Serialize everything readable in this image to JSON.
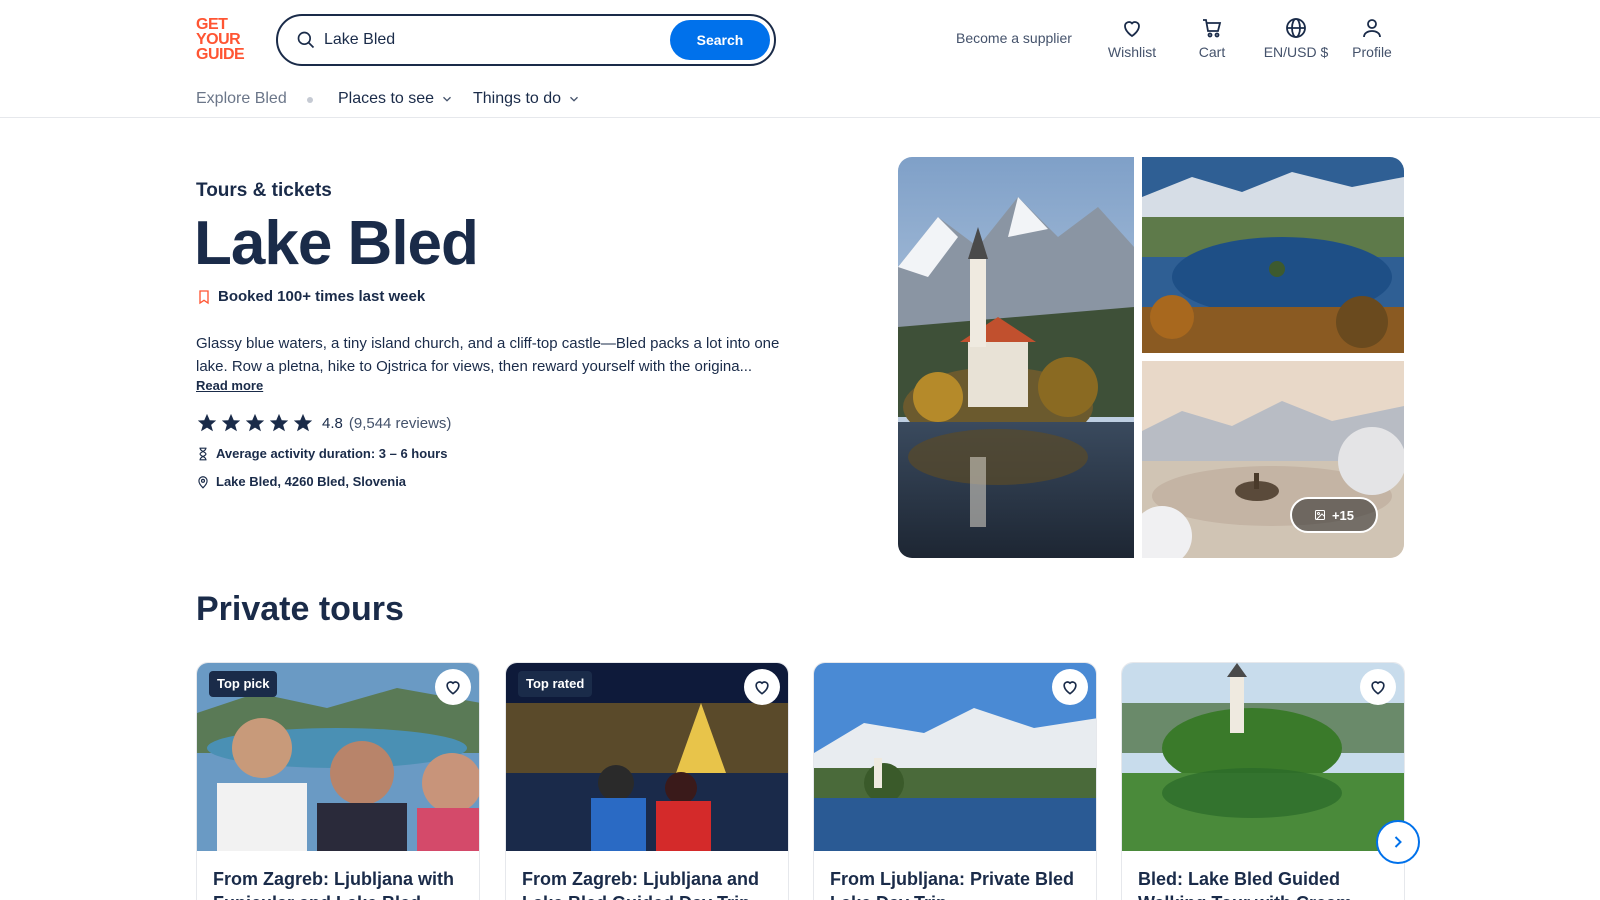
{
  "header": {
    "logo_lines": [
      "GET",
      "YOUR",
      "GUIDE"
    ],
    "search": {
      "value": "Lake Bled",
      "button_label": "Search"
    },
    "supplier_link": "Become a supplier",
    "nav": {
      "wishlist": "Wishlist",
      "cart": "Cart",
      "language": "EN/USD $",
      "profile": "Profile"
    }
  },
  "subnav": {
    "explore": "Explore Bled",
    "places": "Places to see",
    "things": "Things to do"
  },
  "hero": {
    "eyebrow": "Tours & tickets",
    "title": "Lake Bled",
    "booked": "Booked 100+ times last week",
    "description": "Glassy blue waters, a tiny island church, and a cliff-top castle—Bled packs a lot into one lake. Row a pletna, hike to Ojstrica for views, then reward yourself with the origina...",
    "read_more": "Read more",
    "rating": {
      "value": "4.8",
      "count": "(9,544 reviews)",
      "stars": 5
    },
    "duration": "Average activity duration: 3 – 6 hours",
    "location": "Lake Bled, 4260 Bled, Slovenia"
  },
  "gallery": {
    "more_label": "+15"
  },
  "section": {
    "title": "Private tours",
    "cards": [
      {
        "badge": "Top pick",
        "title": "From Zagreb: Ljubljana with Funicular and Lake Bled"
      },
      {
        "badge": "Top rated",
        "title": "From Zagreb: Ljubljana and Lake Bled Guided Day Trip"
      },
      {
        "badge": "",
        "title": "From Ljubljana: Private Bled Lake Day Trip"
      },
      {
        "badge": "",
        "title": "Bled: Lake Bled Guided Walking Tour with Cream Cake"
      }
    ]
  },
  "colors": {
    "brand": "#ff5533",
    "accent": "#0071eb",
    "text": "#1a2b49"
  }
}
